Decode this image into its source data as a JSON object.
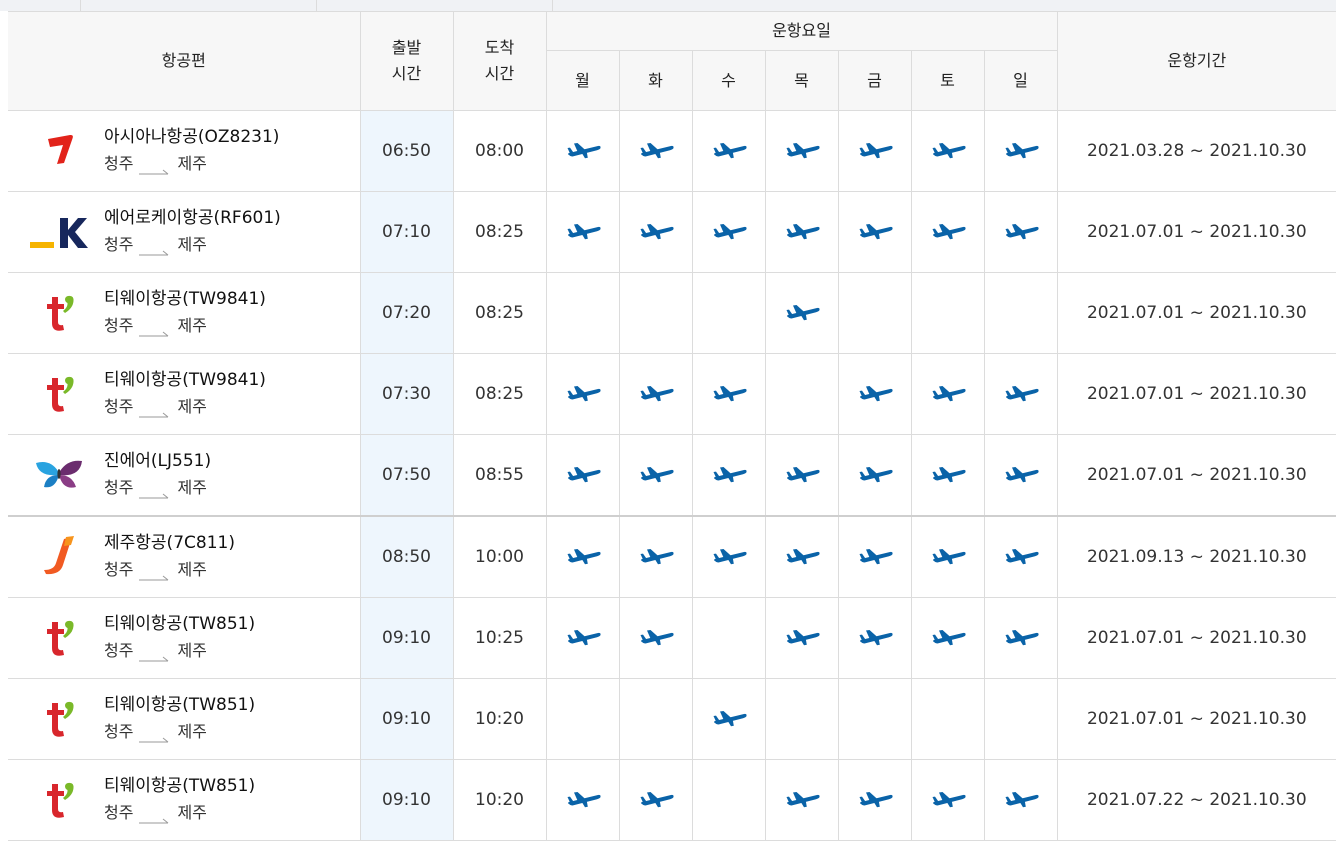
{
  "headers": {
    "flight": "항공편",
    "departure": "출발\n시간",
    "arrival": "도착\n시간",
    "days_group": "운항요일",
    "days": [
      "월",
      "화",
      "수",
      "목",
      "금",
      "토",
      "일"
    ],
    "period": "운항기간"
  },
  "colors": {
    "plane": "#0a63a8",
    "dep_column_bg": "#eef6fd",
    "header_bg": "#f7f7f7",
    "border": "#dcdcdc"
  },
  "route_arrow_icon": "route-arrow-icon",
  "flights": [
    {
      "airline": "asiana",
      "name": "아시아나항공(OZ8231)",
      "from": "청주",
      "to": "제주",
      "dep": "06:50",
      "arr": "08:00",
      "days": [
        true,
        true,
        true,
        true,
        true,
        true,
        true
      ],
      "period": "2021.03.28 ~ 2021.10.30"
    },
    {
      "airline": "airk",
      "name": "에어로케이항공(RF601)",
      "from": "청주",
      "to": "제주",
      "dep": "07:10",
      "arr": "08:25",
      "days": [
        true,
        true,
        true,
        true,
        true,
        true,
        true
      ],
      "period": "2021.07.01 ~ 2021.10.30"
    },
    {
      "airline": "tway",
      "name": "티웨이항공(TW9841)",
      "from": "청주",
      "to": "제주",
      "dep": "07:20",
      "arr": "08:25",
      "days": [
        false,
        false,
        false,
        true,
        false,
        false,
        false
      ],
      "period": "2021.07.01 ~ 2021.10.30"
    },
    {
      "airline": "tway",
      "name": "티웨이항공(TW9841)",
      "from": "청주",
      "to": "제주",
      "dep": "07:30",
      "arr": "08:25",
      "days": [
        true,
        true,
        true,
        false,
        true,
        true,
        true
      ],
      "period": "2021.07.01 ~ 2021.10.30"
    },
    {
      "airline": "jinair",
      "name": "진에어(LJ551)",
      "from": "청주",
      "to": "제주",
      "dep": "07:50",
      "arr": "08:55",
      "days": [
        true,
        true,
        true,
        true,
        true,
        true,
        true
      ],
      "period": "2021.07.01 ~ 2021.10.30"
    },
    {
      "airline": "jejuair",
      "name": "제주항공(7C811)",
      "from": "청주",
      "to": "제주",
      "dep": "08:50",
      "arr": "10:00",
      "days": [
        true,
        true,
        true,
        true,
        true,
        true,
        true
      ],
      "period": "2021.09.13 ~ 2021.10.30"
    },
    {
      "airline": "tway",
      "name": "티웨이항공(TW851)",
      "from": "청주",
      "to": "제주",
      "dep": "09:10",
      "arr": "10:25",
      "days": [
        true,
        true,
        false,
        true,
        true,
        true,
        true
      ],
      "period": "2021.07.01 ~ 2021.10.30"
    },
    {
      "airline": "tway",
      "name": "티웨이항공(TW851)",
      "from": "청주",
      "to": "제주",
      "dep": "09:10",
      "arr": "10:20",
      "days": [
        false,
        false,
        true,
        false,
        false,
        false,
        false
      ],
      "period": "2021.07.01 ~ 2021.10.30"
    },
    {
      "airline": "tway",
      "name": "티웨이항공(TW851)",
      "from": "청주",
      "to": "제주",
      "dep": "09:10",
      "arr": "10:20",
      "days": [
        true,
        true,
        false,
        true,
        true,
        true,
        true
      ],
      "period": "2021.07.22 ~ 2021.10.30"
    }
  ]
}
